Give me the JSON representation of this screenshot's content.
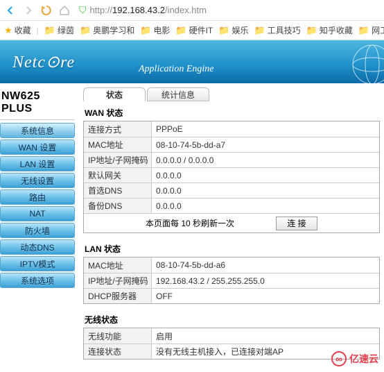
{
  "url_prefix": "http://",
  "url_host": "192.168.43.2",
  "url_path": "/index.htm",
  "bookmarks": {
    "fav": "收藏",
    "items": [
      "绿茵",
      "奥鹏学习和",
      "电影",
      "硬件IT",
      "娱乐",
      "工具技巧",
      "知乎收藏",
      "网工"
    ]
  },
  "brand": {
    "logo": "Netc⊙re",
    "tagline": "Application Engine"
  },
  "model": "NW625 PLUS",
  "menu": [
    "系统信息",
    "WAN 设置",
    "LAN 设置",
    "无线设置",
    "路由",
    "NAT",
    "防火墙",
    "动态DNS",
    "IPTV模式",
    "系统选项"
  ],
  "tabs": [
    "状态",
    "统计信息"
  ],
  "wan": {
    "title": "WAN 状态",
    "rows": [
      {
        "label": "连接方式",
        "value": "PPPoE"
      },
      {
        "label": "MAC地址",
        "value": "08-10-74-5b-dd-a7"
      },
      {
        "label": "IP地址/子网掩码",
        "value": "0.0.0.0 / 0.0.0.0"
      },
      {
        "label": "默认网关",
        "value": "0.0.0.0"
      },
      {
        "label": "首选DNS",
        "value": "0.0.0.0"
      },
      {
        "label": "备份DNS",
        "value": "0.0.0.0"
      }
    ],
    "refresh_text": "本页面每 10 秒刷新一次",
    "connect_btn": "连 接"
  },
  "lan": {
    "title": "LAN 状态",
    "rows": [
      {
        "label": "MAC地址",
        "value": "08-10-74-5b-dd-a6"
      },
      {
        "label": "IP地址/子网掩码",
        "value": "192.168.43.2 / 255.255.255.0"
      },
      {
        "label": "DHCP服务器",
        "value": "OFF"
      }
    ]
  },
  "wlan": {
    "title": "无线状态",
    "rows": [
      {
        "label": "无线功能",
        "value": "启用"
      },
      {
        "label": "连接状态",
        "value": "没有无线主机接入，已连接对端AP"
      }
    ]
  },
  "watermark": "亿速云"
}
